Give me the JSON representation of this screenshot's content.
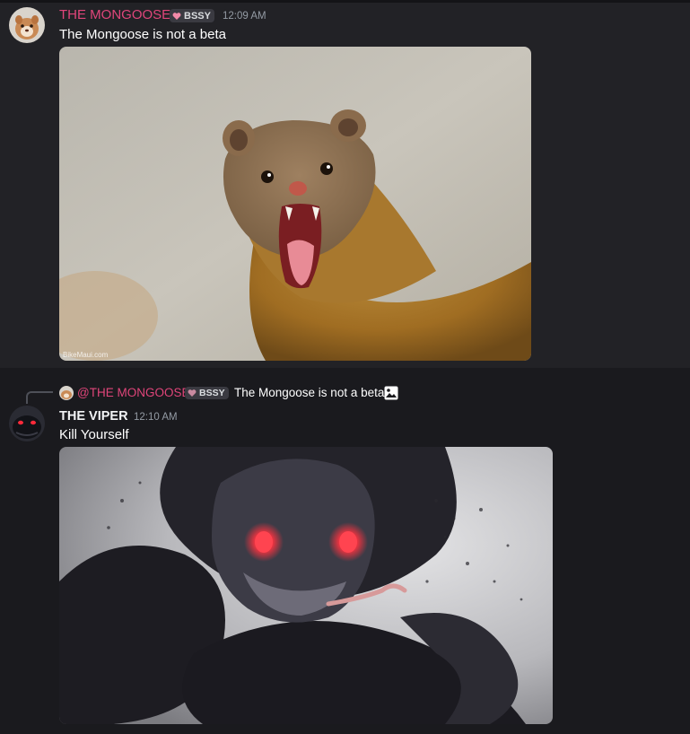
{
  "messages": [
    {
      "author": "THE MONGOOSE",
      "author_color": "#e0457a",
      "badge": "BSSY",
      "timestamp": "12:09 AM",
      "content": "The Mongoose is not a beta",
      "attachment": {
        "kind": "image",
        "description": "photo of a snarling mongoose",
        "watermark": "BikeMaui.com"
      }
    },
    {
      "reply": {
        "author": "@THE MONGOOSE",
        "badge": "BSSY",
        "content": "The Mongoose is not a beta",
        "icon": "image-icon"
      },
      "author": "THE VIPER",
      "author_color": "#f2f3f5",
      "timestamp": "12:10 AM",
      "content": "Kill Yourself",
      "attachment": {
        "kind": "image",
        "description": "dark anime snake with glowing red eyes"
      }
    }
  ]
}
